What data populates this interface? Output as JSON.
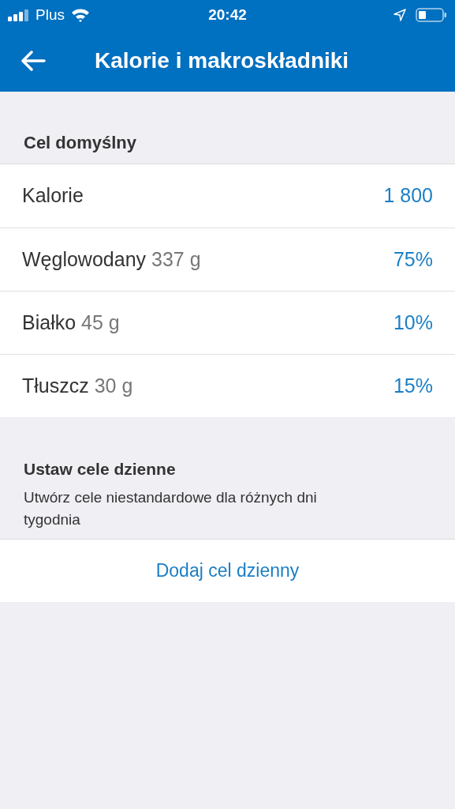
{
  "status_bar": {
    "carrier": "Plus",
    "time": "20:42"
  },
  "header": {
    "title": "Kalorie i makroskładniki"
  },
  "default_goal": {
    "heading": "Cel domyślny",
    "rows": [
      {
        "label": "Kalorie",
        "value": "1 800"
      },
      {
        "label": "Węglowodany",
        "detail": "337 g",
        "value": "75%"
      },
      {
        "label": "Białko",
        "detail": "45 g",
        "value": "10%"
      },
      {
        "label": "Tłuszcz",
        "detail": "30 g",
        "value": "15%"
      }
    ]
  },
  "daily_goals": {
    "heading": "Ustaw cele dzienne",
    "description": "Utwórz cele niestandardowe dla różnych dni tygodnia",
    "action": "Dodaj cel dzienny"
  }
}
